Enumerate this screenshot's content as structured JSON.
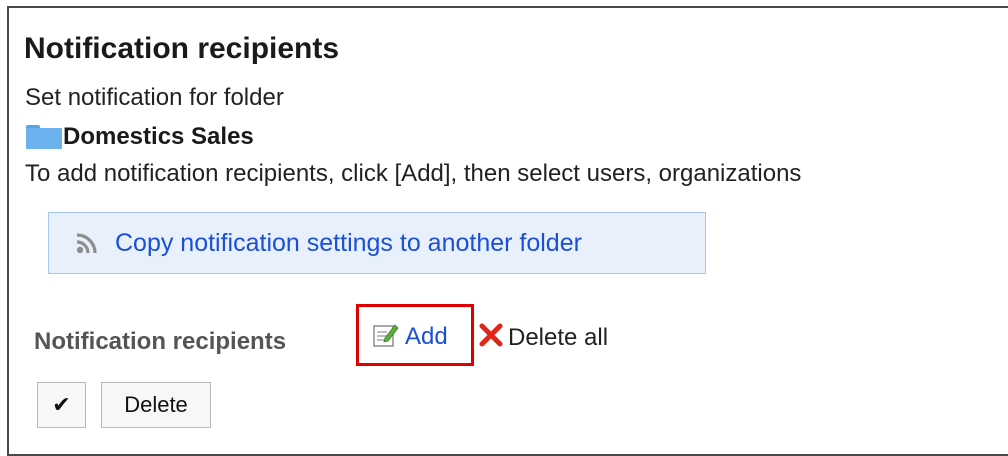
{
  "page": {
    "title": "Notification recipients",
    "subtitle": "Set notification for folder",
    "folder_name": "Domestics Sales",
    "instructions": "To add notification recipients, click [Add], then select users, organizations"
  },
  "copy_action": {
    "label": "Copy notification settings to another folder",
    "icon": "wifi-feed-icon"
  },
  "recipients": {
    "label": "Notification recipients",
    "add_label": "Add",
    "add_icon": "edit-note-icon",
    "delete_all_label": "Delete all",
    "delete_all_icon": "red-x-icon",
    "highlight_color": "#e00000"
  },
  "actions": {
    "select_all_glyph": "✔",
    "delete_label": "Delete"
  }
}
